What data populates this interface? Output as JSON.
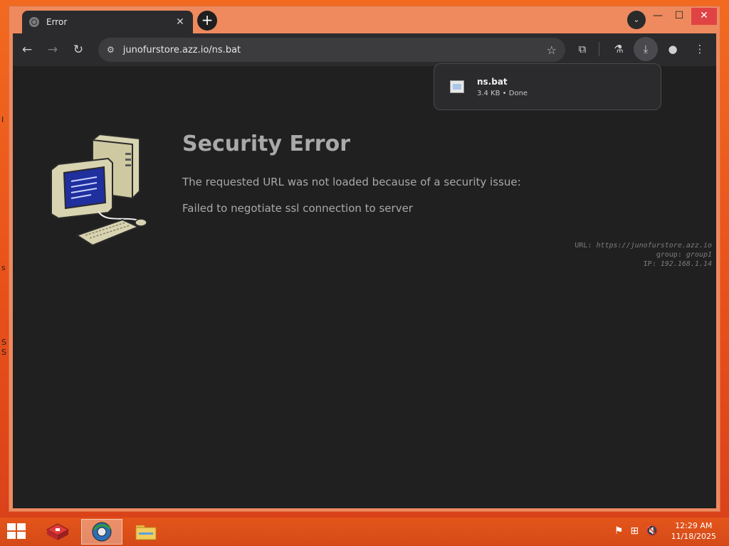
{
  "tab": {
    "title": "Error",
    "close": "✕"
  },
  "omnibox": {
    "url": "junofurstore.azz.io/ns.bat"
  },
  "download": {
    "filename": "ns.bat",
    "status": "3.4 KB • Done"
  },
  "error": {
    "title": "Security Error",
    "line1": "The requested URL was not loaded because of a security issue:",
    "line2": "Failed to negotiate ssl connection to server"
  },
  "meta": {
    "url_label": "URL:",
    "url_value": "https://junofurstore.azz.io",
    "group_label": "group:",
    "group_value": "group1",
    "ip_label": "IP:",
    "ip_value": "192.168.1.14"
  },
  "taskbar": {
    "time": "12:29 AM",
    "date": "11/18/2025"
  },
  "desktop_edge": [
    "I",
    "s",
    "S",
    "S"
  ]
}
